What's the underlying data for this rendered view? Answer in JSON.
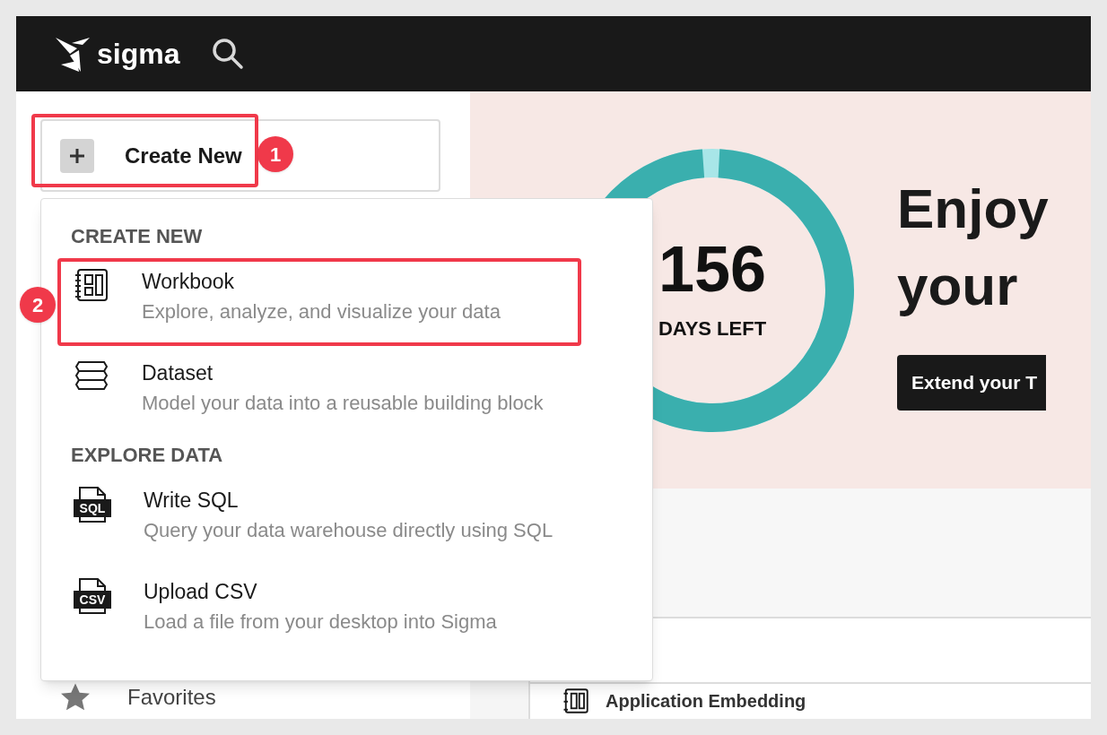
{
  "top_bar": {
    "brand": "sigma"
  },
  "sidebar": {
    "create_button": {
      "label": "Create New",
      "highlighted": true,
      "callout": "1"
    },
    "items": [
      {
        "label": "Favorites"
      }
    ]
  },
  "create_menu": {
    "sections": [
      {
        "heading": "CREATE NEW",
        "items": [
          {
            "kind": "workbook",
            "title": "Workbook",
            "description": "Explore, analyze, and visualize your data",
            "highlighted": true,
            "callout": "2"
          },
          {
            "kind": "dataset",
            "title": "Dataset",
            "description": "Model your data into a reusable building block",
            "highlighted": false
          }
        ]
      },
      {
        "heading": "EXPLORE DATA",
        "items": [
          {
            "kind": "file",
            "file_type": "SQL",
            "title": "Write SQL",
            "description": "Query your data warehouse directly using SQL",
            "highlighted": false
          },
          {
            "kind": "file",
            "file_type": "CSV",
            "title": "Upload CSV",
            "description": "Load a file from your desktop into Sigma",
            "highlighted": false
          }
        ]
      }
    ]
  },
  "trial_banner": {
    "days": "156",
    "days_label": "DAYS LEFT",
    "heading_lines": [
      "Enjoy",
      "your"
    ],
    "button": "Extend your T"
  },
  "documents": [
    {
      "kind": "workbook",
      "title": "Application Embedding"
    }
  ]
}
